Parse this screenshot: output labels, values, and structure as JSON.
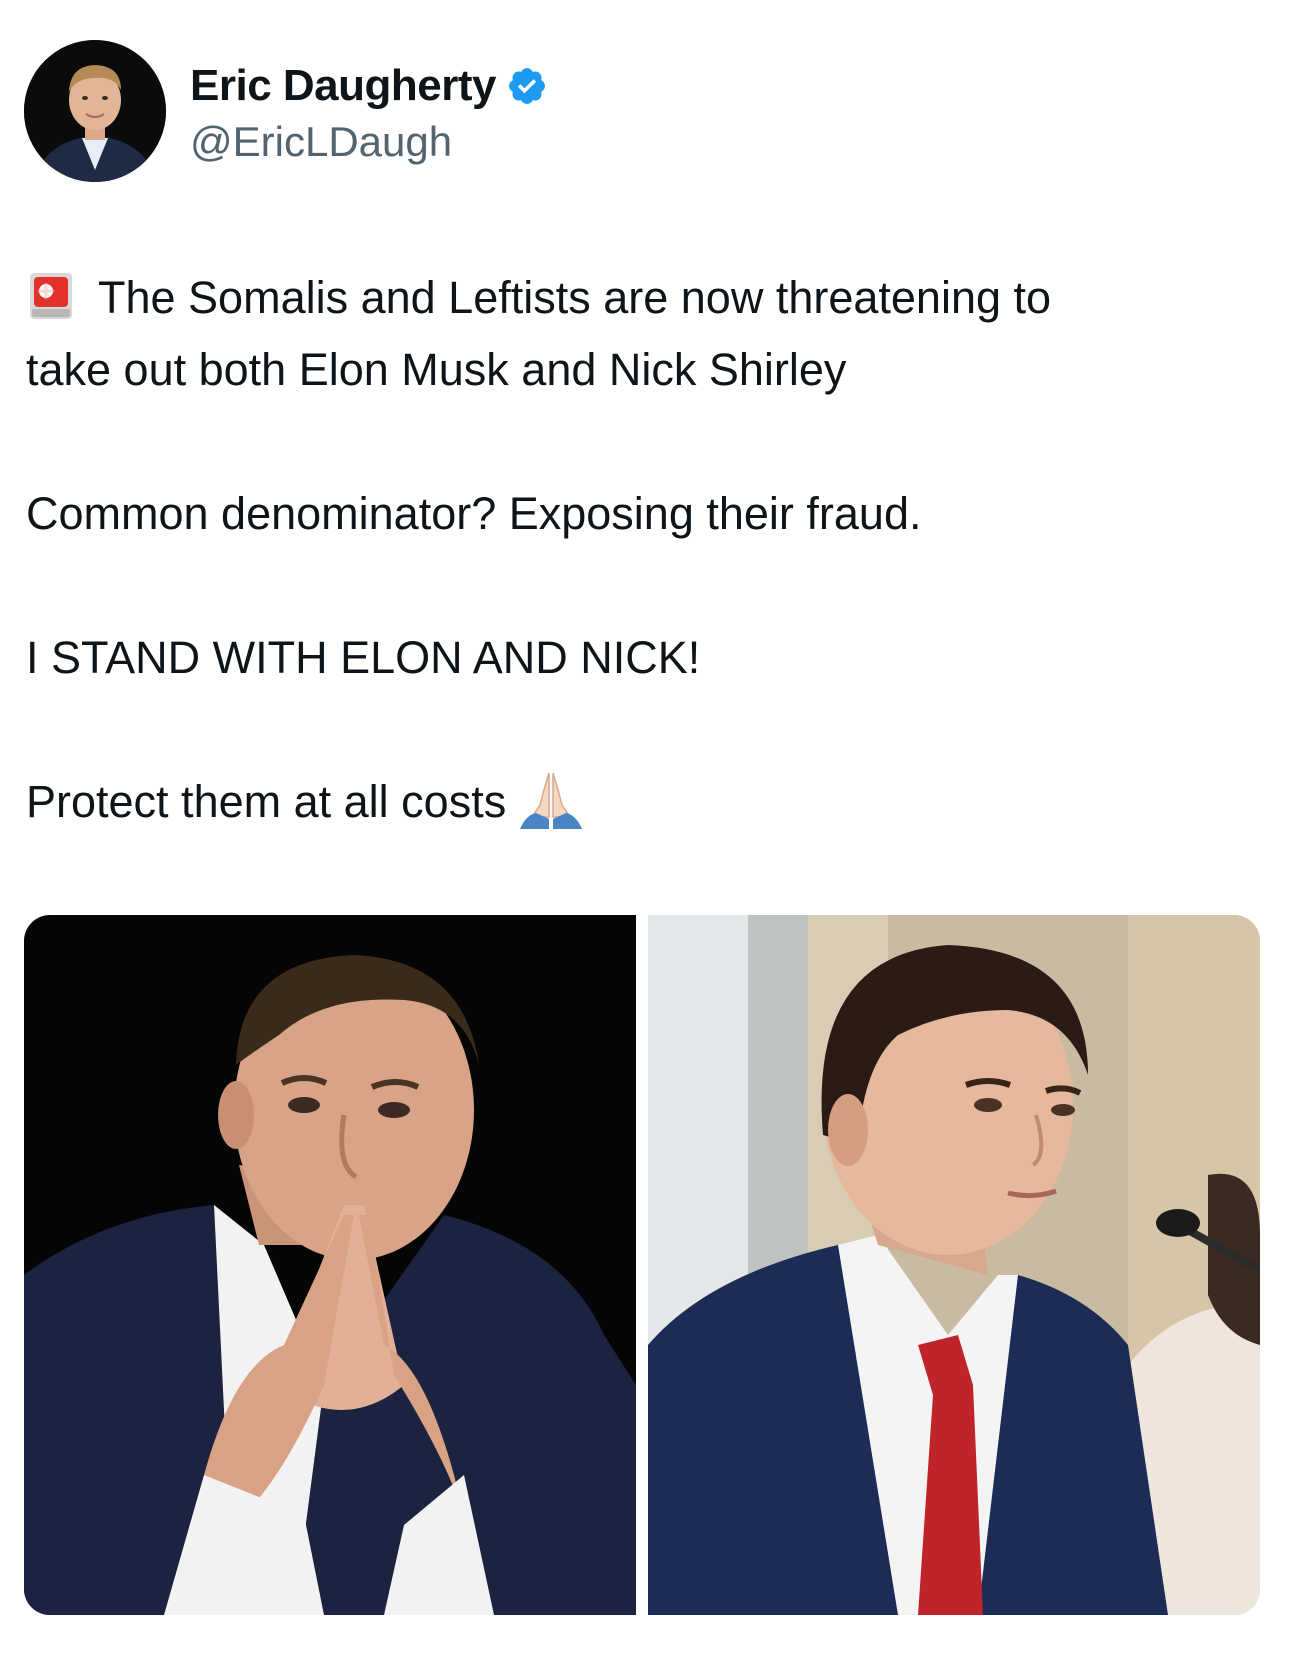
{
  "tweet": {
    "author": {
      "display_name": "Eric Daugherty",
      "handle": "@EricLDaugh",
      "verified": true,
      "avatar_icon": "profile-photo"
    },
    "paragraphs": [
      {
        "prefix_icon": "police-siren-emoji",
        "text": "The Somalis and Leftists are now threatening to"
      },
      {
        "text": "take out both Elon Musk and Nick Shirley"
      },
      {
        "text": "Common denominator? Exposing their fraud."
      },
      {
        "text": "I STAND WITH ELON AND NICK!"
      },
      {
        "text": "Protect them at all costs",
        "suffix_icon": "folded-hands-emoji"
      }
    ],
    "media": [
      {
        "description_icon": "photo-man-dark-suit-hands-clasped"
      },
      {
        "description_icon": "photo-young-man-red-tie-microphone"
      }
    ],
    "colors": {
      "text": "#0f1419",
      "secondary_text": "#536471",
      "verified_badge": "#1d9bf0"
    }
  }
}
